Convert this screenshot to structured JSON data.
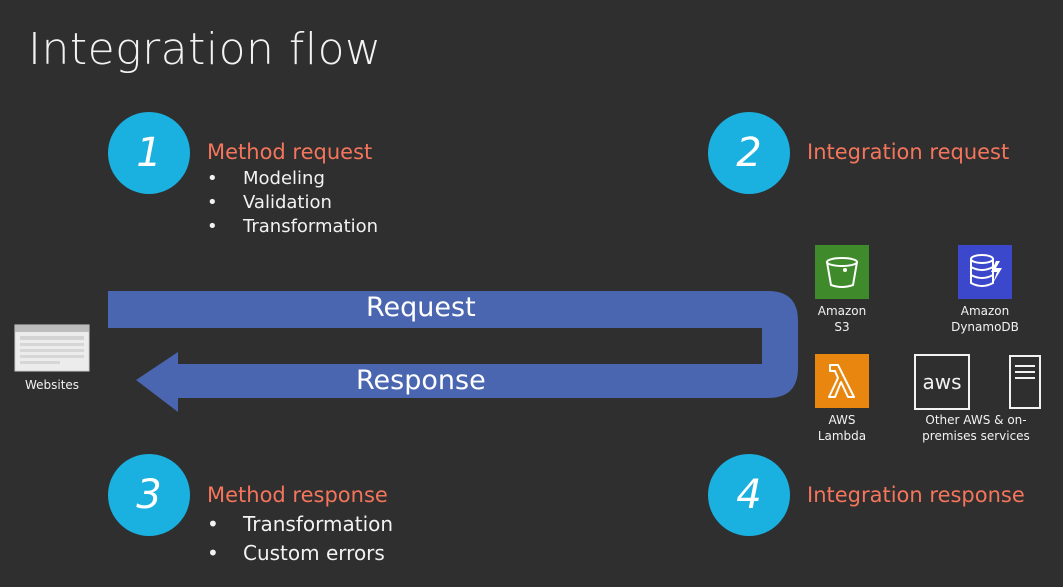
{
  "title": "Integration flow",
  "steps": [
    {
      "number": "1",
      "title": "Method request",
      "items": [
        "Modeling",
        "Validation",
        "Transformation"
      ]
    },
    {
      "number": "2",
      "title": "Integration request",
      "items": []
    },
    {
      "number": "3",
      "title": "Method response",
      "items": [
        "Transformation",
        "Custom errors"
      ]
    },
    {
      "number": "4",
      "title": "Integration response",
      "items": []
    }
  ],
  "flow": {
    "request_label": "Request",
    "response_label": "Response"
  },
  "client": {
    "label": "Websites"
  },
  "services": {
    "s3": {
      "line1": "Amazon",
      "line2": "S3"
    },
    "dynamodb": {
      "line1": "Amazon",
      "line2": "DynamoDB"
    },
    "lambda": {
      "line1": "AWS",
      "line2": "Lambda"
    },
    "other": {
      "line1": "Other AWS & on-",
      "line2": "premises services",
      "aws_logo_text": "aws"
    }
  },
  "colors": {
    "background": "#2f2f2f",
    "step_circle": "#1ab0e0",
    "step_title": "#f4755c",
    "flow_arrow": "#4a66b0",
    "s3": "#3f8b2c",
    "dynamodb": "#3b48cc",
    "lambda": "#e8860f"
  }
}
